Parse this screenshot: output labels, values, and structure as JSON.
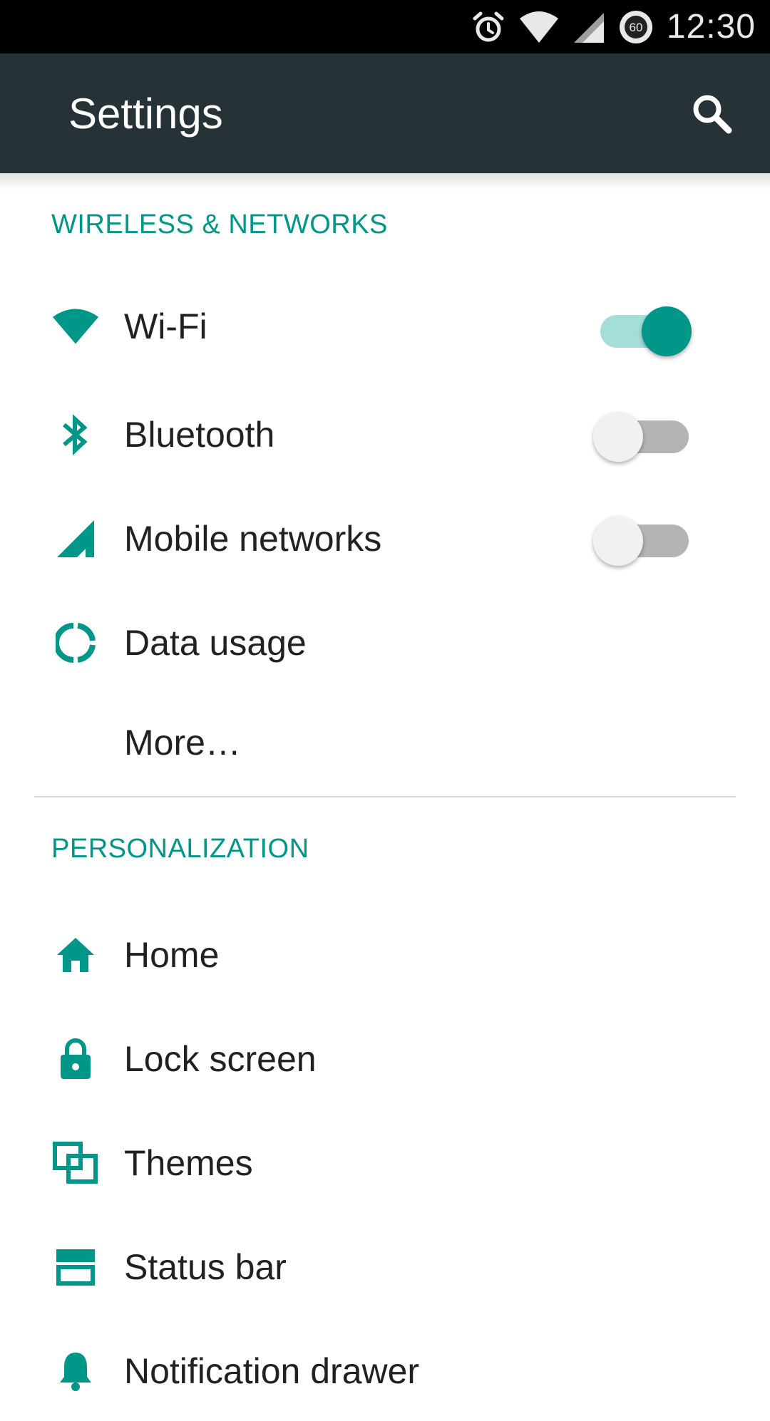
{
  "status_bar": {
    "time": "12:30",
    "battery_badge": "60",
    "icons": [
      "alarm-icon",
      "wifi-signal-icon",
      "cell-signal-icon",
      "battery-icon"
    ]
  },
  "app_bar": {
    "title": "Settings",
    "search_icon": "search-icon"
  },
  "colors": {
    "accent": "#009688",
    "toolbar": "#263238",
    "status_bar": "#000000",
    "text": "#212121"
  },
  "sections": {
    "wireless": {
      "header": "WIRELESS & NETWORKS",
      "items": [
        {
          "label": "Wi-Fi",
          "icon": "wifi-icon",
          "switch": true
        },
        {
          "label": "Bluetooth",
          "icon": "bluetooth-icon",
          "switch": false
        },
        {
          "label": "Mobile networks",
          "icon": "cell-signal-icon",
          "switch": false
        },
        {
          "label": "Data usage",
          "icon": "data-usage-icon"
        },
        {
          "label": "More…",
          "icon": null
        }
      ]
    },
    "personalization": {
      "header": "PERSONALIZATION",
      "items": [
        {
          "label": "Home",
          "icon": "home-icon"
        },
        {
          "label": "Lock screen",
          "icon": "lock-icon"
        },
        {
          "label": "Themes",
          "icon": "themes-icon"
        },
        {
          "label": "Status bar",
          "icon": "status-bar-icon"
        },
        {
          "label": "Notification drawer",
          "icon": "notification-icon"
        }
      ]
    }
  }
}
